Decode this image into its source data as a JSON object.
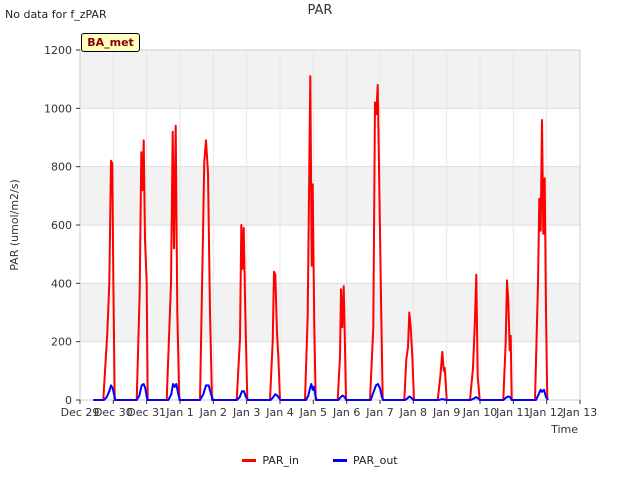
{
  "note": "No data for f_zPAR",
  "badge": "BA_met",
  "chart_data": {
    "type": "line",
    "title": "PAR",
    "xlabel": "Time",
    "ylabel": "PAR (umol/m2/s)",
    "x_range_days": [
      0,
      15
    ],
    "ylim": [
      0,
      1200
    ],
    "x_ticks": [
      "Dec 29",
      "Dec 30",
      "Dec 31",
      "Jan 1",
      "Jan 2",
      "Jan 3",
      "Jan 4",
      "Jan 5",
      "Jan 6",
      "Jan 7",
      "Jan 8",
      "Jan 9",
      "Jan 10",
      "Jan 11",
      "Jan 12",
      "Jan 13"
    ],
    "y_ticks": [
      0,
      200,
      400,
      600,
      800,
      1000,
      1200
    ],
    "grid": true,
    "legend_position": "bottom-center",
    "series": [
      {
        "name": "PAR_in",
        "color": "#ff0000",
        "points": [
          [
            0.4,
            0
          ],
          [
            0.7,
            0
          ],
          [
            0.82,
            230
          ],
          [
            0.88,
            400
          ],
          [
            0.93,
            820
          ],
          [
            0.97,
            810
          ],
          [
            1.0,
            420
          ],
          [
            1.04,
            0
          ],
          [
            1.7,
            0
          ],
          [
            1.79,
            370
          ],
          [
            1.84,
            850
          ],
          [
            1.88,
            720
          ],
          [
            1.91,
            890
          ],
          [
            1.95,
            550
          ],
          [
            2.0,
            400
          ],
          [
            2.03,
            0
          ],
          [
            2.6,
            0
          ],
          [
            2.73,
            400
          ],
          [
            2.78,
            920
          ],
          [
            2.82,
            520
          ],
          [
            2.87,
            940
          ],
          [
            2.92,
            300
          ],
          [
            2.98,
            0
          ],
          [
            3.6,
            0
          ],
          [
            3.73,
            820
          ],
          [
            3.78,
            890
          ],
          [
            3.84,
            780
          ],
          [
            3.9,
            300
          ],
          [
            3.96,
            0
          ],
          [
            4.7,
            0
          ],
          [
            4.8,
            210
          ],
          [
            4.84,
            600
          ],
          [
            4.88,
            450
          ],
          [
            4.91,
            590
          ],
          [
            4.96,
            300
          ],
          [
            5.02,
            0
          ],
          [
            5.7,
            0
          ],
          [
            5.78,
            200
          ],
          [
            5.82,
            440
          ],
          [
            5.86,
            430
          ],
          [
            5.91,
            230
          ],
          [
            5.95,
            150
          ],
          [
            6.0,
            0
          ],
          [
            6.75,
            0
          ],
          [
            6.83,
            290
          ],
          [
            6.87,
            700
          ],
          [
            6.91,
            1110
          ],
          [
            6.95,
            460
          ],
          [
            6.98,
            740
          ],
          [
            7.03,
            250
          ],
          [
            7.07,
            0
          ],
          [
            7.73,
            0
          ],
          [
            7.8,
            150
          ],
          [
            7.83,
            380
          ],
          [
            7.87,
            250
          ],
          [
            7.91,
            390
          ],
          [
            7.94,
            230
          ],
          [
            7.98,
            0
          ],
          [
            8.7,
            0
          ],
          [
            8.8,
            250
          ],
          [
            8.85,
            1020
          ],
          [
            8.89,
            980
          ],
          [
            8.93,
            1080
          ],
          [
            8.97,
            800
          ],
          [
            9.03,
            350
          ],
          [
            9.08,
            0
          ],
          [
            9.73,
            0
          ],
          [
            9.79,
            140
          ],
          [
            9.84,
            180
          ],
          [
            9.88,
            300
          ],
          [
            9.92,
            250
          ],
          [
            9.97,
            150
          ],
          [
            10.02,
            0
          ],
          [
            10.73,
            0
          ],
          [
            10.81,
            80
          ],
          [
            10.87,
            165
          ],
          [
            10.91,
            100
          ],
          [
            10.94,
            110
          ],
          [
            10.97,
            60
          ],
          [
            11.0,
            0
          ],
          [
            11.7,
            0
          ],
          [
            11.79,
            110
          ],
          [
            11.85,
            280
          ],
          [
            11.89,
            430
          ],
          [
            11.93,
            80
          ],
          [
            11.96,
            40
          ],
          [
            11.99,
            0
          ],
          [
            12.7,
            0
          ],
          [
            12.77,
            200
          ],
          [
            12.81,
            410
          ],
          [
            12.85,
            340
          ],
          [
            12.89,
            170
          ],
          [
            12.92,
            220
          ],
          [
            12.95,
            0
          ],
          [
            13.65,
            0
          ],
          [
            13.74,
            400
          ],
          [
            13.78,
            690
          ],
          [
            13.82,
            580
          ],
          [
            13.86,
            960
          ],
          [
            13.9,
            570
          ],
          [
            13.94,
            760
          ],
          [
            13.98,
            300
          ],
          [
            14.02,
            0
          ]
        ]
      },
      {
        "name": "PAR_out",
        "color": "#0000ff",
        "points": [
          [
            0.4,
            0
          ],
          [
            0.72,
            0
          ],
          [
            0.8,
            10
          ],
          [
            0.88,
            30
          ],
          [
            0.93,
            50
          ],
          [
            0.98,
            40
          ],
          [
            1.02,
            20
          ],
          [
            1.06,
            0
          ],
          [
            1.7,
            0
          ],
          [
            1.78,
            15
          ],
          [
            1.85,
            50
          ],
          [
            1.91,
            55
          ],
          [
            1.96,
            40
          ],
          [
            2.02,
            0
          ],
          [
            2.65,
            0
          ],
          [
            2.74,
            20
          ],
          [
            2.79,
            55
          ],
          [
            2.84,
            45
          ],
          [
            2.89,
            55
          ],
          [
            2.95,
            20
          ],
          [
            3.0,
            0
          ],
          [
            3.6,
            0
          ],
          [
            3.7,
            20
          ],
          [
            3.78,
            50
          ],
          [
            3.86,
            50
          ],
          [
            3.93,
            20
          ],
          [
            3.99,
            0
          ],
          [
            4.7,
            0
          ],
          [
            4.79,
            10
          ],
          [
            4.86,
            30
          ],
          [
            4.92,
            30
          ],
          [
            4.98,
            10
          ],
          [
            5.04,
            0
          ],
          [
            5.72,
            0
          ],
          [
            5.8,
            10
          ],
          [
            5.86,
            20
          ],
          [
            5.92,
            15
          ],
          [
            5.98,
            5
          ],
          [
            6.02,
            0
          ],
          [
            6.78,
            0
          ],
          [
            6.85,
            15
          ],
          [
            6.9,
            40
          ],
          [
            6.94,
            55
          ],
          [
            6.98,
            35
          ],
          [
            7.02,
            45
          ],
          [
            7.07,
            10
          ],
          [
            7.1,
            0
          ],
          [
            7.75,
            0
          ],
          [
            7.82,
            10
          ],
          [
            7.88,
            15
          ],
          [
            7.94,
            10
          ],
          [
            7.99,
            0
          ],
          [
            8.72,
            0
          ],
          [
            8.8,
            25
          ],
          [
            8.88,
            50
          ],
          [
            8.94,
            55
          ],
          [
            9.0,
            40
          ],
          [
            9.06,
            10
          ],
          [
            9.1,
            0
          ],
          [
            9.75,
            0
          ],
          [
            9.82,
            5
          ],
          [
            9.88,
            12
          ],
          [
            9.94,
            8
          ],
          [
            10.0,
            0
          ],
          [
            10.75,
            0
          ],
          [
            10.88,
            3
          ],
          [
            10.98,
            0
          ],
          [
            11.72,
            0
          ],
          [
            11.82,
            5
          ],
          [
            11.88,
            10
          ],
          [
            11.94,
            6
          ],
          [
            12.0,
            0
          ],
          [
            12.7,
            0
          ],
          [
            12.78,
            8
          ],
          [
            12.84,
            12
          ],
          [
            12.9,
            10
          ],
          [
            12.96,
            0
          ],
          [
            13.68,
            0
          ],
          [
            13.76,
            20
          ],
          [
            13.82,
            35
          ],
          [
            13.86,
            28
          ],
          [
            13.92,
            35
          ],
          [
            13.98,
            10
          ],
          [
            14.04,
            0
          ]
        ]
      }
    ]
  }
}
